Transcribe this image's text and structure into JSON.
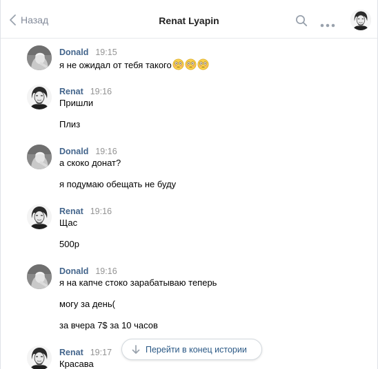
{
  "header": {
    "back_label": "Назад",
    "title": "Renat Lyapin",
    "icons": {
      "back": "chevron-left-icon",
      "search": "search-icon",
      "more": "more-icon"
    }
  },
  "messages": [
    {
      "author": "Donald",
      "time": "19:15",
      "lines": [
        "я не ожидал от тебя такого"
      ],
      "emoji_count": 3
    },
    {
      "author": "Renat",
      "time": "19:16",
      "lines": [
        "Пришли",
        "Плиз"
      ]
    },
    {
      "author": "Donald",
      "time": "19:16",
      "lines": [
        "а скоко донат?",
        "я подумаю обещать не буду"
      ]
    },
    {
      "author": "Renat",
      "time": "19:16",
      "lines": [
        "Щас",
        "500р"
      ]
    },
    {
      "author": "Donald",
      "time": "19:16",
      "lines": [
        "я на капче стоко зарабатываю теперь",
        "могу за день(",
        "за вчера 7$ за 10 часов"
      ]
    },
    {
      "author": "Renat",
      "time": "19:17",
      "lines": [
        "Красава"
      ]
    }
  ],
  "jump_button": {
    "label": "Перейти в конец истории",
    "icon": "arrow-down-icon"
  },
  "colors": {
    "author": "#42648b",
    "time": "#939393",
    "link": "#2a5885",
    "muted": "#828a99",
    "divider": "#e7e8ec"
  }
}
